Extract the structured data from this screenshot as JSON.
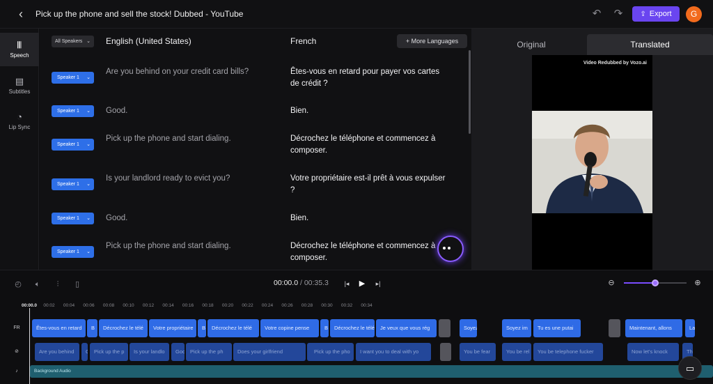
{
  "header": {
    "title": "Pick up the phone and sell the stock! Dubbed - YouTube",
    "export_label": "Export",
    "avatar_initial": "G"
  },
  "rail": {
    "items": [
      {
        "label": "Speech",
        "icon": "waveform-icon"
      },
      {
        "label": "Subtitles",
        "icon": "subtitles-icon"
      },
      {
        "label": "Lip Sync",
        "icon": "lip-sync-icon"
      }
    ]
  },
  "transcript": {
    "speaker_filter": "All Speakers",
    "source_language": "English (United States)",
    "target_language": "French",
    "more_languages": "More Languages",
    "rows": [
      {
        "speaker": "Speaker 1",
        "source": "Are you behind on your credit card bills?",
        "target": "Êtes-vous en retard pour payer vos cartes de crédit ?"
      },
      {
        "speaker": "Speaker 1",
        "source": "Good.",
        "target": "Bien."
      },
      {
        "speaker": "Speaker 1",
        "source": "Pick up the phone and start dialing.",
        "target": "Décrochez le téléphone et commencez à composer."
      },
      {
        "speaker": "Speaker 1",
        "source": "Is your landlord ready to evict you?",
        "target": "Votre propriétaire est-il prêt à vous expulser ?"
      },
      {
        "speaker": "Speaker 1",
        "source": "Good.",
        "target": "Bien."
      },
      {
        "speaker": "Speaker 1",
        "source": "Pick up the phone and start dialing.",
        "target": "Décrochez le téléphone et commencez à composer."
      }
    ]
  },
  "preview": {
    "tab_original": "Original",
    "tab_translated": "Translated",
    "watermark": "Video Redubbed by Vozo.ai"
  },
  "transport": {
    "current_time": "00:00.0",
    "total_time": "00:35.3",
    "zoom_level": 0.5
  },
  "timeline": {
    "ruler": [
      "00:00.0",
      "00:02",
      "00:04",
      "00:06",
      "00:08",
      "00:10",
      "00:12",
      "00:14",
      "00:16",
      "00:18",
      "00:20",
      "00:22",
      "00:24",
      "00:26",
      "00:28",
      "00:30",
      "00:32",
      "00:34"
    ],
    "fr_label": "FR",
    "fr_clips": [
      "Êtes-vous en retard",
      "B",
      "Décrochez le télé",
      "Votre propriétaire",
      "B",
      "Décrochez le télé",
      "Votre copine pense",
      "B",
      "Décrochez le télé",
      "Je veux que vous rég",
      "",
      "Soyez",
      "Soyez im",
      "Tu es une putai",
      "",
      "Maintenant, allons",
      "La"
    ],
    "en_clips": [
      "Are you behind",
      "G",
      "Pick up the p",
      "Is your landlo",
      "Goo",
      "Pick up the ph",
      "Does your girlfriend",
      "Go",
      "Pick up the pho",
      "I want you to deal with yo",
      "",
      "You be fear",
      "You be rel",
      "You be telephone fucker",
      "Now let's knock",
      "Th"
    ],
    "audio_label": "Background Audio"
  }
}
